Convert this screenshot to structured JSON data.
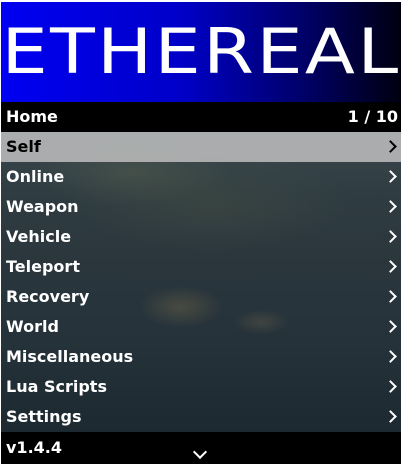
{
  "banner": {
    "title": "ETHEREAL"
  },
  "header": {
    "section": "Home",
    "position": "1 / 10"
  },
  "menu_items": [
    {
      "label": "Self",
      "icon": "chevron-right-icon",
      "selected": true
    },
    {
      "label": "Online",
      "icon": "chevron-right-icon",
      "selected": false
    },
    {
      "label": "Weapon",
      "icon": "chevron-right-icon",
      "selected": false
    },
    {
      "label": "Vehicle",
      "icon": "chevron-right-icon",
      "selected": false
    },
    {
      "label": "Teleport",
      "icon": "chevron-right-icon",
      "selected": false
    },
    {
      "label": "Recovery",
      "icon": "chevron-right-icon",
      "selected": false
    },
    {
      "label": "World",
      "icon": "chevron-right-icon",
      "selected": false
    },
    {
      "label": "Miscellaneous",
      "icon": "chevron-right-icon",
      "selected": false
    },
    {
      "label": "Lua Scripts",
      "icon": "chevron-right-icon",
      "selected": false
    },
    {
      "label": "Settings",
      "icon": "chevron-right-icon",
      "selected": false
    }
  ],
  "footer": {
    "version": "v1.4.4",
    "scroll_icon": "chevron-down-icon"
  },
  "colors": {
    "banner_blue": "#0000f2",
    "bar_black": "#000000",
    "selected_bg": "#bebebe",
    "text": "#ffffff"
  }
}
